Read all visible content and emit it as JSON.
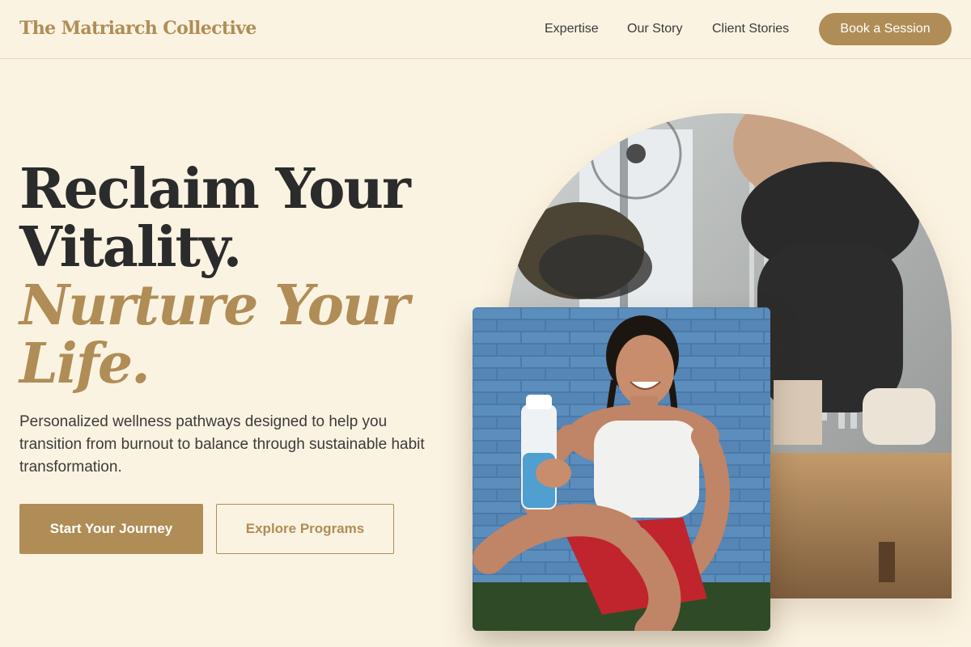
{
  "brand": {
    "name": "The Matriarch Collective"
  },
  "nav": {
    "links": [
      "Expertise",
      "Our Story",
      "Client Stories"
    ],
    "cta_label": "Book a Session"
  },
  "hero": {
    "headline_line1": "Reclaim Your",
    "headline_line2": "Vitality.",
    "accent_line1": "Nurture Your",
    "accent_line2": "Life.",
    "description": "Personalized wellness pathways designed to help you transition from burnout to balance through sustainable habit transformation.",
    "primary_cta": "Start Your Journey",
    "secondary_cta": "Explore Programs"
  },
  "images": {
    "arch": "box-jump-gym-photo",
    "card": "smiling-woman-with-shaker-bottle-photo"
  },
  "colors": {
    "background": "#fbf3e1",
    "accent": "#b08d57",
    "text": "#2b2b2b"
  }
}
